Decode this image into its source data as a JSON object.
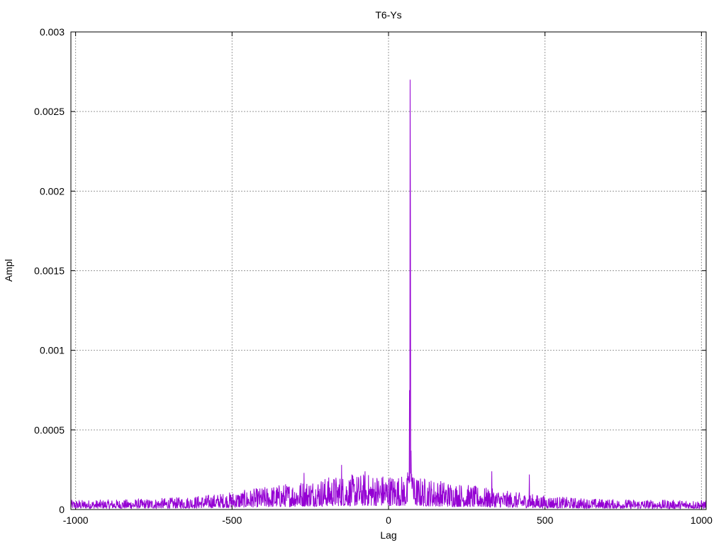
{
  "chart_data": {
    "type": "line",
    "title": "T6-Ys",
    "xlabel": "Lag",
    "ylabel": "Ampl",
    "xlim": [
      -1015,
      1015
    ],
    "ylim": [
      0,
      0.003
    ],
    "xticks": [
      -1000,
      -500,
      0,
      500,
      1000
    ],
    "xtick_labels": [
      "-1000",
      "-500",
      "0",
      "500",
      "1000"
    ],
    "yticks": [
      0,
      0.0005,
      0.001,
      0.0015,
      0.002,
      0.0025,
      0.003
    ],
    "ytick_labels": [
      "0",
      "0.0005",
      "0.001",
      "0.0015",
      "0.002",
      "0.0025",
      "0.003"
    ],
    "grid": true,
    "legend": "none",
    "series": [
      {
        "color": "#9400d3",
        "description": "noisy amplitude vs lag, envelope near 0.00005 at edges rising to ~0.00015 around center, sharp peak at lag ~69",
        "peak": {
          "x": 69,
          "y": 0.0027
        },
        "secondary_peaks": [
          {
            "x": 70,
            "y": 0.00188
          },
          {
            "x": 67,
            "y": 0.00075
          },
          {
            "x": 72,
            "y": 0.00037
          },
          {
            "x": -270,
            "y": 0.00023
          },
          {
            "x": -150,
            "y": 0.00028
          },
          {
            "x": -75,
            "y": 0.00024
          },
          {
            "x": 330,
            "y": 0.00024
          },
          {
            "x": 450,
            "y": 0.00022
          }
        ],
        "x_range": [
          -1015,
          1015
        ]
      }
    ]
  }
}
